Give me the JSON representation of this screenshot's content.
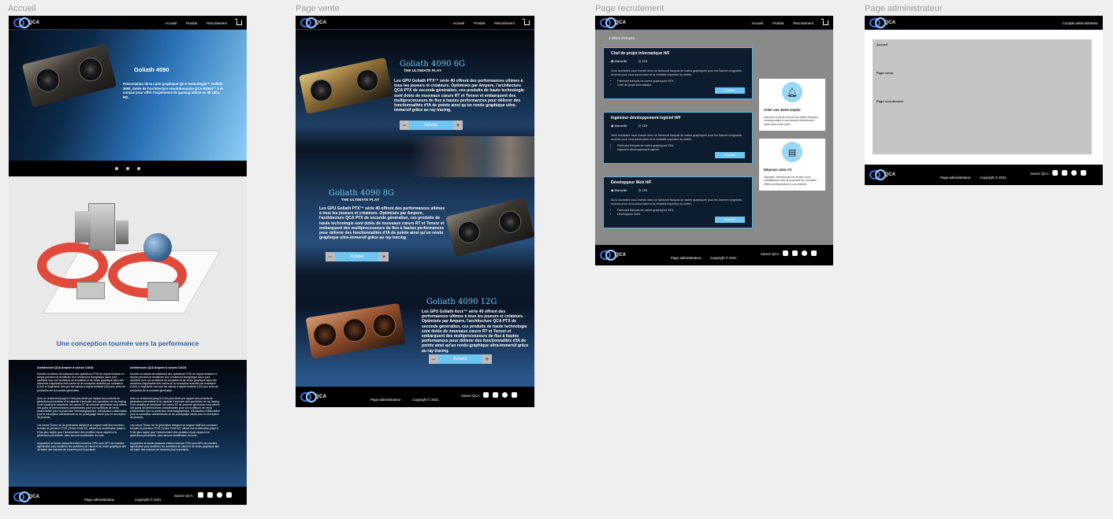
{
  "frames": {
    "accueil": "Accueil",
    "vente": "Page vente",
    "recrutement": "Page recrutement",
    "admin": "Page administrateur"
  },
  "nav": {
    "logo": "QCA",
    "links": [
      "Accueil",
      "Produit",
      "Recrutement"
    ],
    "admin_link": "Compte administrateur"
  },
  "footer": {
    "admin": "Page administrateur",
    "copyright": "Copyright © 2021",
    "follow": "Suivez QCA :"
  },
  "accueil": {
    "hero_title": "Goliath 4090",
    "hero_text": "Présentation de la carte graphique QCA technologie™ Goliath 3600, dotée de l'architecture révolutionnaire QCA RDNA™ 2 et conçue pour offrir l'expérience de gaming ultime en 4k Ultra HD.",
    "performance_title": "Une conception tournée vers la performance",
    "columns": [
      {
        "title": "Architecture QCA Ampere à coeurs CUDA",
        "paras": [
          "Doublez la vitesse de traitement des opérations FP32 de virgule flottante en simple précision et bénéficiez d'un rendement énergétique accru pour accélérer tous vos workflows de simulation et de rendu graphique dans des domaines d'application très variés de la conception assistée par ordinateur (CAO) à l'ingénierie, tels que les calculs à virgule flottante (32x) aux voies de production de la nouvelle génération.",
          "Avec un rendement jusqu'à 2 fois plus élevé par rapport aux produits de génération précédente et la capacité d'exécuter des opérations de ray tracing et de shading en simultané, les cœurs RT de seconde génération vous offrent des gains de performances considérables pour vos workflows de rendu photoréaliste pour la production cinématographique, d'évaluation collaborative pour la conception architecturale ou de prototypage virtuel pour la conception de produits.",
          "Les cœurs Tensor de 3e génération intègrent un support natif des nouveaux formats de précision TF32 (Tensor Float 32), offrant une accélération jusqu'à 5 fois plus rapide pour l'entraînement des modèles IA par rapport à la génération précédente, sans aucune modification du code.",
          "Augmentez la bande passante d'interconnexion GPU-vers-GPU de manière significative pour accélérer les workflows de calcul et de rendu graphique afin de traiter des volumes de données plus importants."
        ]
      },
      {
        "title": "Architecture QCA Ampere à coeurs CUDA",
        "paras": [
          "Doublez la vitesse de traitement des opérations FP32 de virgule flottante en simple précision et bénéficiez d'un rendement énergétique accru pour accélérer tous vos workflows de simulation et de rendu graphique dans des domaines d'application très variés de la conception assistée par ordinateur (CAO) à l'ingénierie, tels que les calculs à virgule flottante (32x) aux voies de production de la nouvelle génération.",
          "Avec un rendement jusqu'à 2 fois plus élevé par rapport aux produits de génération précédente et la capacité d'exécuter des opérations de ray tracing et de shading en simultané, les cœurs RT de seconde génération vous offrent des gains de performances considérables pour vos workflows de rendu photoréaliste pour la production cinématographique, d'évaluation collaborative pour la conception architecturale ou de prototypage virtuel pour la conception de produits.",
          "Les cœurs Tensor de 3e génération intègrent un support natif des nouveaux formats de précision TF32 (Tensor Float 32), offrant une accélération jusqu'à 5 fois plus rapide pour l'entraînement des modèles IA par rapport à la génération précédente, sans aucune modification du code.",
          "Augmentez la bande passante d'interconnexion GPU-vers-GPU de manière significative pour accélérer les workflows de calcul et de rendu graphique afin de traiter des volumes de données plus importants."
        ]
      }
    ]
  },
  "vente": {
    "products": [
      {
        "title": "Goliath 4090 6G",
        "subtitle": "THE ULTIMATE PLAY",
        "text": "Les GPU Goliath PTX™ série 40 offrent des performances ultimes à tous les joueurs et créateurs. Optimisés par Ampere, l'architecture QCA PTX de seconde génération, ces produits de haute technologie sont dotés de nouveaux cœurs RT et Tensor et embarquent des multiprocesseurs de flux à hautes performances pour délivrer des fonctionnalités d'IA de pointe ainsi qu'un rendu graphique ultra-immersif grâce au ray tracing."
      },
      {
        "title": "Goliath 4090 8G",
        "subtitle": "THE ULTIMATE PLAY",
        "text": "Les GPU Goliath PTX™ série 40 offrent des performances ultimes à tous les joueurs et créateurs. Optimisés par Ampere, l'architecture QCA PTX de seconde génération, ces produits de haute technologie sont dotés de nouveaux cœurs RT et Tensor et embarquent des multiprocesseurs de flux à hautes performances pour délivrer des fonctionnalités d'IA de pointe ainsi qu'un rendu graphique ultra-immersif grâce au ray tracing."
      },
      {
        "title": "Goliath 4090 12G",
        "subtitle": "",
        "text": "Les GPU Goliath 4xxx™ série 40 offrent des performances ultimes à tous les joueurs et créateurs. Optimisés par Ampere, l'architecture QCA PTX de seconde génération, ces produits de haute technologie sont dotés de nouveaux cœurs RT et Tensor et embarquent des multiprocesseurs de flux à hautes performances pour délivrer des fonctionnalités d'IA de pointe ainsi qu'un rendu graphique ultra-immersif grâce au ray tracing."
      }
    ],
    "buy_label": "Acheter",
    "minus": "−",
    "plus": "+"
  },
  "recrutement": {
    "count": "3 offres d'emploi",
    "location": "Marseille",
    "contract": "CDI",
    "jobs": [
      {
        "title": "Chef de projet informatique H/F",
        "desc": "Vous souhaitez vous investir chez un fabricant français de cartes graphiques pour les Gamers exigeants, recevez pour vous savoir-faire et la véritable expertise du métier.",
        "bullets": [
          "Fabricant français de cartes graphiques 93%.",
          "Chef de projet informatique."
        ],
        "apply": "Postuler"
      },
      {
        "title": "Ingénieur développement logiciel H/F",
        "desc": "Vous souhaitez vous investir chez un fabricant français de cartes graphiques pour les Gamers exigeants, recevez pour vous savoir-faire et la véritable expertise du métier.",
        "bullets": [
          "Fabricant français de cartes graphiques 93%.",
          "Ingénieur développement logiciel."
        ],
        "apply": "Postuler"
      },
      {
        "title": "Développeur Web H/F",
        "desc": "Vous souhaitez vous investir chez un fabricant français de cartes graphiques pour les Gamers exigeants, recevez pour vous savoir-faire et la véritable expertise du métier.",
        "bullets": [
          "Fabricant français de cartes graphiques 93%.",
          "Développeur Web."
        ],
        "apply": "Postuler"
      }
    ],
    "alert_title": "Créer une alerte emploi",
    "alert_text": "Inscrivez-vous et recevez les offres d'emploi correspondant à vos besoins directement dans votre boîte mail.",
    "cv_title": "Déposez votre CV",
    "cv_text": "Déposez, sélectionnez et rendez vous candidatures afin de proposer de nouvelles offres correspondant à vos critères."
  },
  "admin": {
    "items": [
      "Accueil",
      "Page vente",
      "Page recrutement"
    ]
  },
  "colors": {
    "accent": "#6fc4f0",
    "brand_blue": "#3c6de0",
    "nav_bg": "#000000"
  }
}
